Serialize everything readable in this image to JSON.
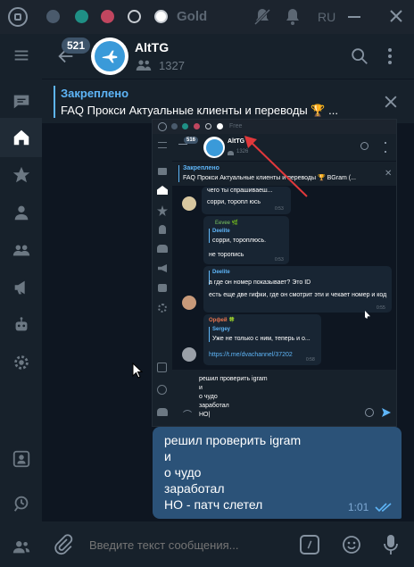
{
  "titlebar": {
    "dot_colors": [
      "#4a5a6c",
      "#1f8f85",
      "#c0465f",
      "#2a2f36",
      "#ffffff"
    ],
    "title": "Gold",
    "lang": "RU"
  },
  "header": {
    "back_badge": "521",
    "chat_name": "AltTG",
    "members_count": "1327"
  },
  "pinned": {
    "label": "Закреплено",
    "text": "FAQ  Прокси  Актуальные клиенты и переводы  🏆 ..."
  },
  "inner": {
    "titlebar_label": "Free",
    "back_badge": "516",
    "chat_name": "AltTG",
    "members_count": "1326",
    "pinned_label": "Закреплено",
    "pinned_text": "FAQ  Прокси  Актуальные клиенты и переводы  🏆 BGram (...",
    "messages": [
      {
        "text1": "чего ты спрашиваеш...",
        "text2": "сорри, торопл юсь",
        "time": "0:53"
      },
      {
        "author": "Eevee 🌿",
        "reply": "Deelite",
        "reply_text": "сорри, тороплюсь.",
        "text": "не торопись",
        "time": "0:53"
      },
      {
        "reply": "Deelite",
        "text1": "а где он номер показывает? Это ID",
        "text2": "есть еще две гифки, где он смотрит эти и чекает номер и код",
        "time": "0:55"
      },
      {
        "author": "Орфей 🍀",
        "reply": "Sergey",
        "reply_text": "Уже не только с ним, теперь и о...",
        "link": "https://t.me/dvachannel/37202",
        "time": "0:58"
      }
    ],
    "composer_lines": [
      "решил проверить igram",
      "и",
      "о чудо",
      "заработал",
      "НО|"
    ]
  },
  "outgoing": {
    "lines": [
      "решил проверить igram",
      "и",
      "о чудо",
      "заработал",
      "НО - патч слетел"
    ],
    "time": "1:01"
  },
  "composer": {
    "placeholder": "Введите текст сообщения..."
  },
  "colors": {
    "accent": "#5eb5f7",
    "bg": "#0e1621",
    "panel": "#17212b",
    "outgoing": "#2b5278",
    "arrow": "#e0383b"
  }
}
